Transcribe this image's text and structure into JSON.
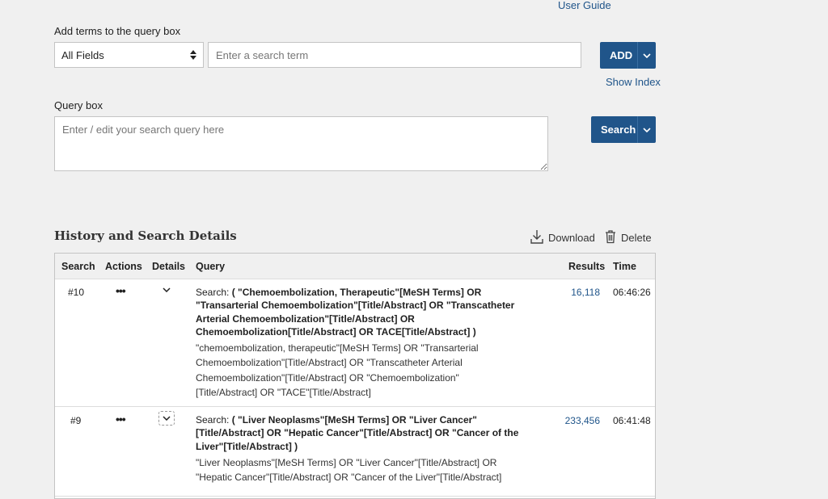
{
  "header": {
    "user_guide": "User Guide"
  },
  "builder": {
    "label": "Add terms to the query box",
    "field_select": "All Fields",
    "term_placeholder": "Enter a search term",
    "add_label": "ADD",
    "show_index": "Show Index"
  },
  "query": {
    "label": "Query box",
    "placeholder": "Enter / edit your search query here",
    "search_label": "Search"
  },
  "history": {
    "title": "History and Search Details",
    "download": "Download",
    "delete": "Delete",
    "columns": [
      "Search",
      "Actions",
      "Details",
      "Query",
      "Results",
      "Time"
    ],
    "rows": [
      {
        "num": "#10",
        "actions": "•••",
        "prefix": "Search: ",
        "query": "( \"Chemoembolization, Therapeutic\"[MeSH Terms] OR \"Transarterial Chemoembolization\"[Title/Abstract] OR \"Transcatheter Arterial Chemoembolization\"[Title/Abstract] OR Chemoembolization[Title/Abstract] OR TACE[Title/Abstract] )",
        "translation": "\"chemoembolization, therapeutic\"[MeSH Terms] OR \"Transarterial Chemoembolization\"[Title/Abstract] OR \"Transcatheter Arterial Chemoembolization\"[Title/Abstract] OR \"Chemoembolization\"[Title/Abstract] OR \"TACE\"[Title/Abstract]",
        "results": "16,118",
        "time": "06:46:26"
      },
      {
        "num": "#9",
        "actions": "•••",
        "prefix": "Search: ",
        "query": "( \"Liver Neoplasms\"[MeSH Terms] OR \"Liver Cancer\"[Title/Abstract] OR \"Hepatic Cancer\"[Title/Abstract] OR \"Cancer of the Liver\"[Title/Abstract] )",
        "translation": "\"Liver Neoplasms\"[MeSH Terms] OR \"Liver Cancer\"[Title/Abstract] OR \"Hepatic Cancer\"[Title/Abstract] OR \"Cancer of the Liver\"[Title/Abstract]",
        "results": "233,456",
        "time": "06:41:48"
      }
    ]
  },
  "colors": {
    "accent": "#20558a",
    "background": "#f0f0f0"
  }
}
